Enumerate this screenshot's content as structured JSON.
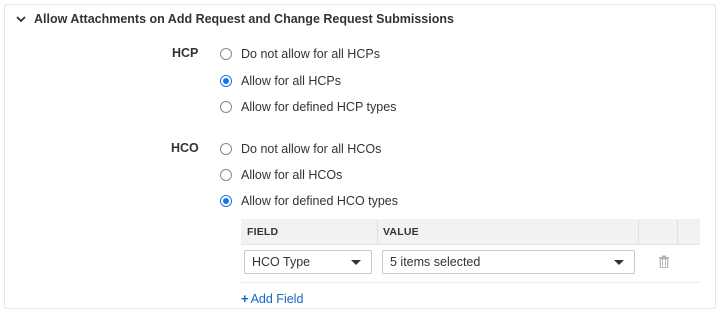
{
  "section": {
    "title": "Allow Attachments on Add Request and Change Request Submissions"
  },
  "hcp": {
    "label": "HCP",
    "options": [
      {
        "label": "Do not allow for all HCPs",
        "checked": false
      },
      {
        "label": "Allow for all HCPs",
        "checked": true
      },
      {
        "label": "Allow for defined HCP types",
        "checked": false
      }
    ]
  },
  "hco": {
    "label": "HCO",
    "options": [
      {
        "label": "Do not allow for all HCOs",
        "checked": false
      },
      {
        "label": "Allow for all HCOs",
        "checked": false
      },
      {
        "label": "Allow for defined HCO types",
        "checked": true
      }
    ]
  },
  "table": {
    "headers": {
      "field": "FIELD",
      "value": "VALUE"
    },
    "rows": [
      {
        "field": "HCO Type",
        "value": "5 items selected"
      }
    ]
  },
  "add_field": {
    "label": "Add Field",
    "icon": "+"
  },
  "colors": {
    "accent": "#1a73e8",
    "link": "#1a66c2"
  }
}
